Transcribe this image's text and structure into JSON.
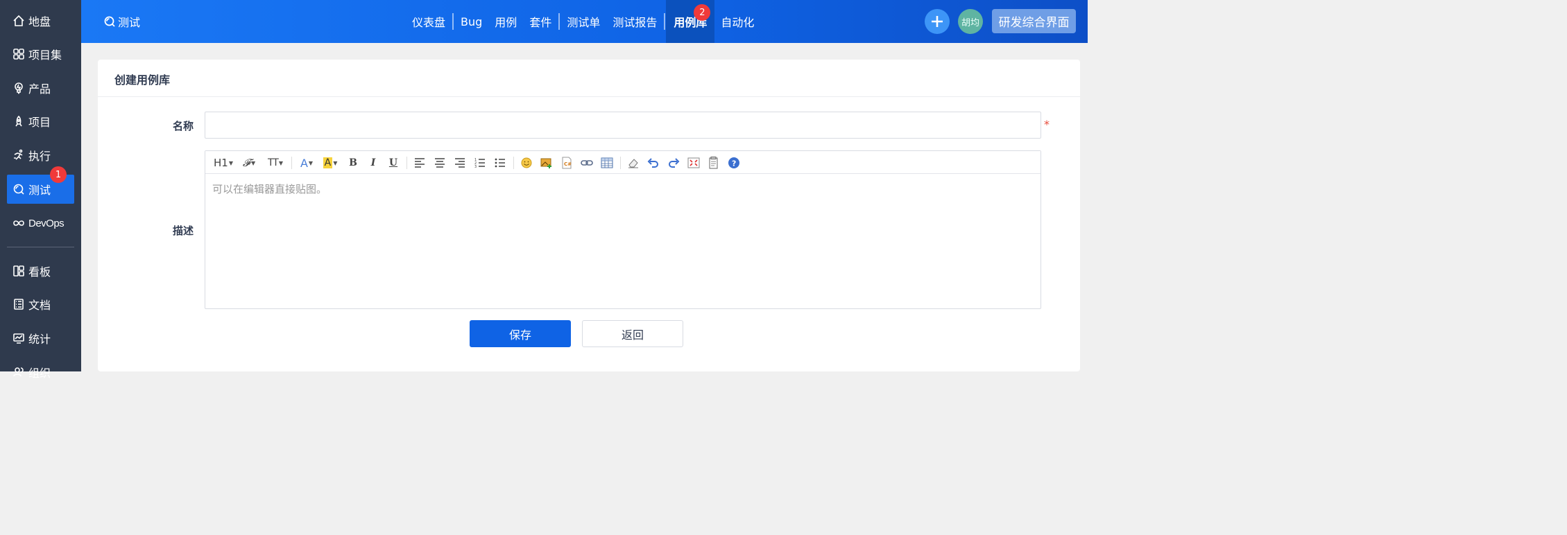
{
  "sidebar": {
    "items": [
      {
        "label": "地盘",
        "icon": "home-icon"
      },
      {
        "label": "项目集",
        "icon": "grid-icon"
      },
      {
        "label": "产品",
        "icon": "lightbulb-icon"
      },
      {
        "label": "项目",
        "icon": "rocket-icon"
      },
      {
        "label": "执行",
        "icon": "run-icon"
      },
      {
        "label": "测试",
        "icon": "test-icon",
        "badge": "1"
      },
      {
        "label": "DevOps",
        "icon": "infinity-icon"
      },
      {
        "label": "看板",
        "icon": "board-icon"
      },
      {
        "label": "文档",
        "icon": "document-icon"
      },
      {
        "label": "统计",
        "icon": "chart-icon"
      },
      {
        "label": "组织",
        "icon": "people-icon"
      }
    ]
  },
  "header": {
    "title": "测试",
    "tabs": [
      {
        "label": "仪表盘"
      },
      {
        "label": "Bug"
      },
      {
        "label": "用例"
      },
      {
        "label": "套件"
      },
      {
        "label": "测试单"
      },
      {
        "label": "测试报告"
      },
      {
        "label": "用例库",
        "badge": "2"
      },
      {
        "label": "自动化"
      }
    ],
    "avatar_text": "胡均",
    "ui_button": "研发综合界面"
  },
  "form": {
    "title": "创建用例库",
    "name_label": "名称",
    "name_value": "",
    "required_mark": "*",
    "desc_label": "描述",
    "desc_placeholder": "可以在编辑器直接贴图。",
    "save_label": "保存",
    "back_label": "返回"
  },
  "editor_toolbar": {
    "heading": "H1",
    "font": "𝓕",
    "size": "TT",
    "bold": "B",
    "italic": "I",
    "underline": "U"
  },
  "colors": {
    "accent": "#0f63e5",
    "sidebar_bg": "#2f3a4d",
    "badge": "#f03a3a",
    "required": "#e74c3c"
  }
}
